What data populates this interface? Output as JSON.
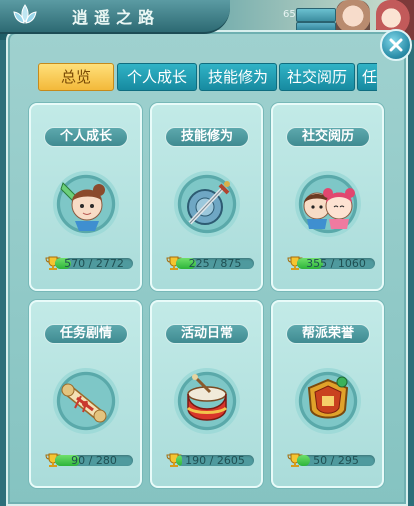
{
  "window": {
    "title": "逍遥之路"
  },
  "scene": {
    "hp_value": "65"
  },
  "tabs": [
    {
      "label": "总览",
      "active": true
    },
    {
      "label": "个人成长",
      "active": false
    },
    {
      "label": "技能修为",
      "active": false
    },
    {
      "label": "社交阅历",
      "active": false
    },
    {
      "label": "任",
      "active": false
    }
  ],
  "cards": [
    {
      "label": "个人成长",
      "icon": "warrior-portrait-icon",
      "progress_text": "570 / 2772",
      "progress": 0.205
    },
    {
      "label": "技能修为",
      "icon": "sword-shield-icon",
      "progress_text": "225 / 875",
      "progress": 0.257
    },
    {
      "label": "社交阅历",
      "icon": "companions-portrait-icon",
      "progress_text": "355 / 1060",
      "progress": 0.335
    },
    {
      "label": "任务剧情",
      "icon": "scroll-icon",
      "progress_text": "90 / 280",
      "progress": 0.321
    },
    {
      "label": "活动日常",
      "icon": "drum-icon",
      "progress_text": "190 / 2605",
      "progress": 0.073
    },
    {
      "label": "帮派荣誉",
      "icon": "gang-badge-icon",
      "progress_text": "50 / 295",
      "progress": 0.169
    }
  ],
  "colors": {
    "accent_gold": "#f3b93a",
    "tab_blue": "#178aa0",
    "progress_green": "#2db43a"
  }
}
